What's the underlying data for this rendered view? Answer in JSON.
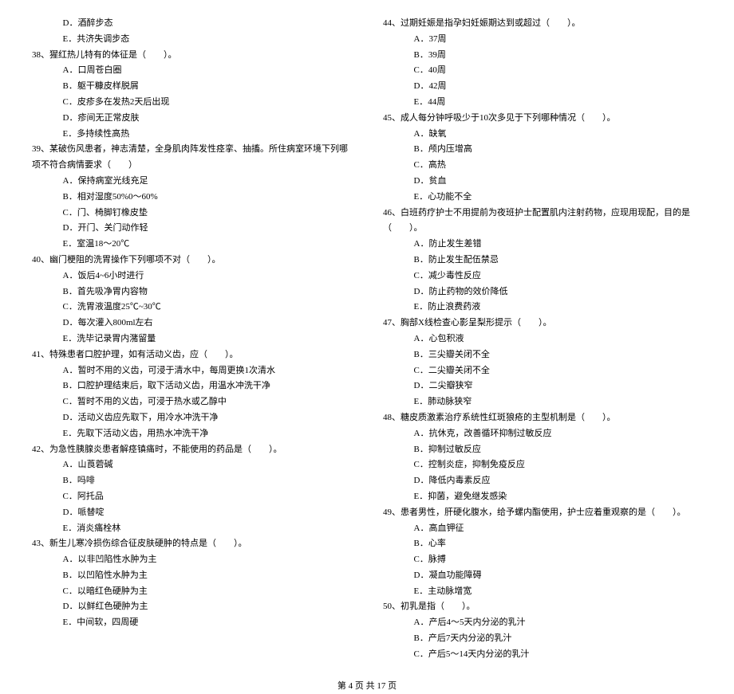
{
  "left": {
    "pre_opts": [
      "D．酒醉步态",
      "E．共济失调步态"
    ],
    "q38": "38、猩红热儿特有的体征是（　　）。",
    "q38_opts": [
      "A．口周苍白圈",
      "B．躯干糠皮样脱屑",
      "C．皮疹多在发热2天后出现",
      "D．疹间无正常皮肤",
      "E．多持续性高热"
    ],
    "q39": "39、某破伤风患者，神志清楚，全身肌肉阵发性痉挛、抽搐。所住病室环境下列哪项不符合病情要求（　　）",
    "q39_opts": [
      "A．保持病室光线充足",
      "B．相对湿度50%0～60%",
      "C．门、椅脚钉橡皮垫",
      "D．开门、关门动作轻",
      "E．室温18～20℃"
    ],
    "q40": "40、幽门梗阻的洗胃操作下列哪项不对（　　）。",
    "q40_opts": [
      "A．饭后4~6小时进行",
      "B．首先吸净胃内容物",
      "C．洗胃液温度25℃~30℃",
      "D．每次灌入800ml左右",
      "E．洗毕记录胃内潴留量"
    ],
    "q41": "41、特殊患者口腔护理，如有活动义齿，应（　　）。",
    "q41_opts": [
      "A．暂时不用的义齿，可浸于清水中，每周更换1次清水",
      "B．口腔护理结束后，取下活动义齿，用温水冲洗干净",
      "C．暂时不用的义齿，可浸于热水或乙醇中",
      "D．活动义齿应先取下，用冷水冲洗干净",
      "E．先取下活动义齿，用热水冲洗干净"
    ],
    "q42": "42、为急性胰腺炎患者解痉镇痛时，不能使用的药品是（　　）。",
    "q42_opts": [
      "A．山莨菪碱",
      "B．吗啡",
      "C．阿托品",
      "D．哌替啶",
      "E．消炎痛栓林"
    ],
    "q43": "43、新生儿寒冷损伤综合征皮肤硬肿的特点是（　　）。",
    "q43_opts": [
      "A．以非凹陷性水肿为主",
      "B．以凹陷性水肿为主",
      "C．以暗红色硬肿为主",
      "D．以鲜红色硬肿为主",
      "E．中间软，四周硬"
    ]
  },
  "right": {
    "q44": "44、过期妊娠是指孕妇妊娠期达到或超过（　　）。",
    "q44_opts": [
      "A．37周",
      "B．39周",
      "C．40周",
      "D．42周",
      "E．44周"
    ],
    "q45": "45、成人每分钟呼吸少于10次多见于下列哪种情况（　　）。",
    "q45_opts": [
      "A．缺氧",
      "B．颅内压增高",
      "C．高热",
      "D．贫血",
      "E．心功能不全"
    ],
    "q46": "46、白班药疗护士不用提前为夜班护士配置肌内注射药物，应现用现配，目的是（　　）。",
    "q46_opts": [
      "A．防止发生差错",
      "B．防止发生配伍禁忌",
      "C．减少毒性反应",
      "D．防止药物的效价降低",
      "E．防止浪费药液"
    ],
    "q47": "47、胸部X线检查心影呈梨形提示（　　）。",
    "q47_opts": [
      "A．心包积液",
      "B．三尖瓣关闭不全",
      "C．二尖瓣关闭不全",
      "D．二尖瓣狭窄",
      "E．肺动脉狭窄"
    ],
    "q48": "48、糖皮质激素治疗系统性红斑狼疮的主型机制是（　　）。",
    "q48_opts": [
      "A．抗休克，改善循环抑制过敏反应",
      "B．抑制过敏反应",
      "C．控制炎症，抑制免疫反应",
      "D．降低内毒素反应",
      "E．抑菌，避免继发感染"
    ],
    "q49": "49、患者男性，肝硬化腹水，给予螺内酯使用，护士应着重观察的是（　　）。",
    "q49_opts": [
      "A．高血钾征",
      "B．心率",
      "C．脉搏",
      "D．凝血功能障碍",
      "E．主动脉增宽"
    ],
    "q50": "50、初乳是指（　　）。",
    "q50_opts": [
      "A．产后4～5天内分泌的乳汁",
      "B．产后7天内分泌的乳汁",
      "C．产后5～14天内分泌的乳汁"
    ]
  },
  "footer": "第 4 页 共 17 页"
}
